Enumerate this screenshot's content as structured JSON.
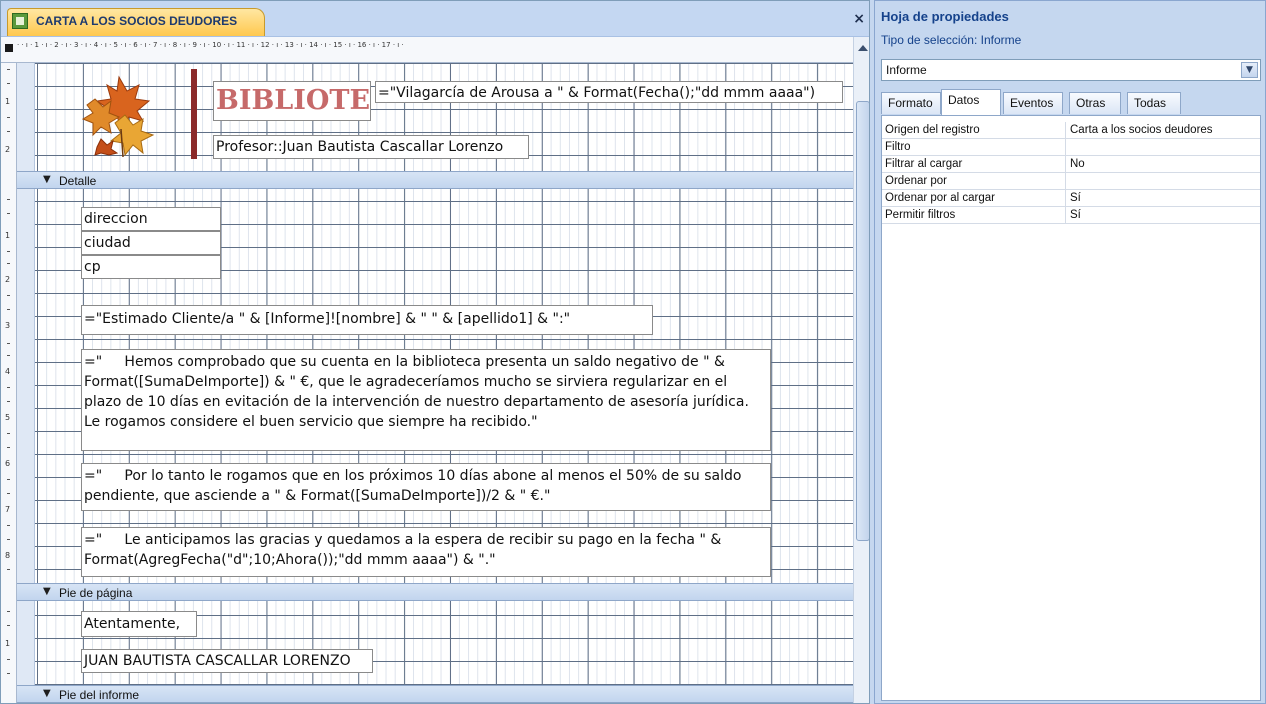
{
  "document_tab": {
    "title": "CARTA A LOS SOCIOS DEUDORES",
    "close_glyph": "×",
    "icon": "report-icon"
  },
  "ruler": {
    "horizontal_marks": "· · ı · 1 · ı · 2 · ı · 3 · ı · 4 · ı · 5 · ı · 6 · ı · 7 · ı · 8 · ı · 9 · ı · 10 · ı · 11 · ı · 12 · ı · 13 · ı · 14 · ı · 15 · ı · 16 · ı · 17 · ı ·",
    "vertical_marks": [
      "1",
      "2",
      "1",
      "2",
      "3",
      "4",
      "5",
      "6",
      "7",
      "8",
      "1"
    ]
  },
  "header": {
    "title": "BIBLIOTECA",
    "date_expr": "=\"Vilagarcía de Arousa a \" & Format(Fecha();\"dd mmm aaaa\")",
    "teacher": "Profesor::Juan Bautista Cascallar Lorenzo"
  },
  "bands": {
    "detail": "Detalle",
    "page_footer": "Pie de página",
    "report_footer": "Pie del informe"
  },
  "detail": {
    "fields": [
      "direccion",
      "ciudad",
      "cp"
    ],
    "greeting_expr": "=\"Estimado Cliente/a \" & [Informe]![nombre] & \" \" & [apellido1] & \":\"",
    "paragraph1_expr": "=\"     Hemos comprobado que su cuenta en la biblioteca presenta un saldo negativo de \" & Format([SumaDeImporte]) & \" €, que le agradeceríamos mucho se sirviera regularizar en el plazo de 10 días en evitación de la intervención de nuestro departamento de asesoría jurídica. Le rogamos considere el buen servicio que siempre ha recibido.\"",
    "paragraph2_expr": "=\"     Por lo tanto le rogamos que en los próximos 10 días abone al menos el 50% de su saldo pendiente, que asciende a \" & Format([SumaDeImporte])/2 & \" €.\"",
    "paragraph3_expr": "=\"     Le anticipamos las gracias y quedamos a la espera de recibir su pago en la fecha \" & Format(AgregFecha(\"d\";10;Ahora());\"dd mmm aaaa\") & \".\""
  },
  "footer": {
    "closing": "Atentamente,",
    "signature": "JUAN BAUTISTA CASCALLAR LORENZO"
  },
  "property_sheet": {
    "title": "Hoja de propiedades",
    "selection_type": "Tipo de selección:  Informe",
    "selected_object": "Informe",
    "tabs": [
      "Formato",
      "Datos",
      "Eventos",
      "Otras",
      "Todas"
    ],
    "active_tab": "Datos",
    "rows": [
      {
        "key": "Origen del registro",
        "value": "Carta a los socios deudores"
      },
      {
        "key": "Filtro",
        "value": ""
      },
      {
        "key": "Filtrar al cargar",
        "value": "No"
      },
      {
        "key": "Ordenar por",
        "value": ""
      },
      {
        "key": "Ordenar por al cargar",
        "value": "Sí"
      },
      {
        "key": "Permitir filtros",
        "value": "Sí"
      }
    ]
  },
  "colors": {
    "tab_active": "#ffc84e",
    "band": "#c2d5ee",
    "title_text": "#c66a6a",
    "panel_bg": "#c5d7ef",
    "panel_title": "#15428b"
  }
}
